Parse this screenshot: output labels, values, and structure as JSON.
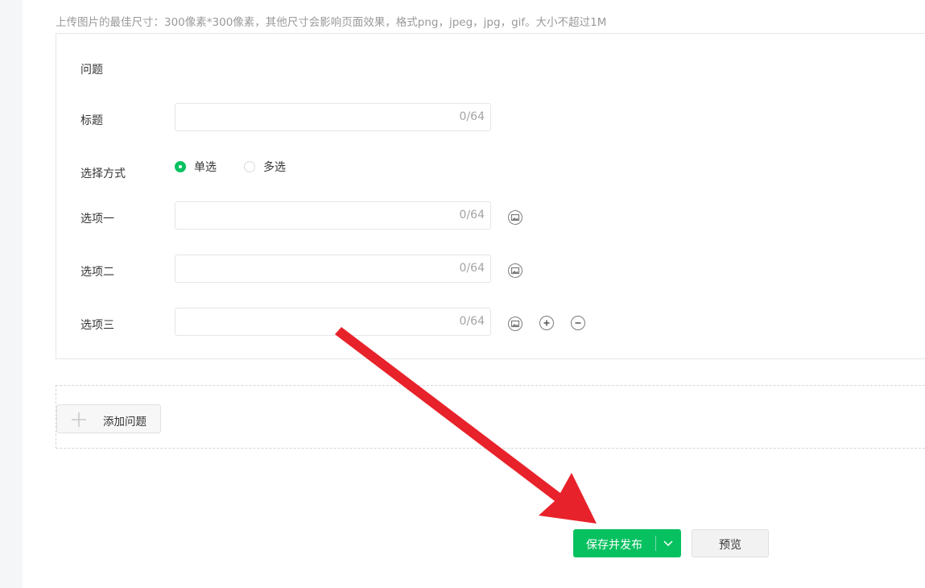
{
  "upload_hint": "上传图片的最佳尺寸：300像素*300像素，其他尺寸会影响页面效果，格式png，jpeg，jpg，gif。大小不超过1M",
  "question": {
    "heading": "问题",
    "title_label": "标题",
    "title_counter": "0/64",
    "mode_label": "选择方式",
    "modes": [
      {
        "label": "单选",
        "selected": true
      },
      {
        "label": "多选",
        "selected": false
      }
    ],
    "options": [
      {
        "label": "选项一",
        "counter": "0/64"
      },
      {
        "label": "选项二",
        "counter": "0/64"
      },
      {
        "label": "选项三",
        "counter": "0/64"
      }
    ]
  },
  "add_question_label": "添加问题",
  "actions": {
    "publish_label": "保存并发布",
    "preview_label": "预览"
  },
  "colors": {
    "accent": "#07c160",
    "annotation_arrow": "#e8222a"
  },
  "icons": [
    "image-icon",
    "plus-circle-icon",
    "minus-circle-icon",
    "plus-icon",
    "chevron-down-icon",
    "red-arrow"
  ]
}
